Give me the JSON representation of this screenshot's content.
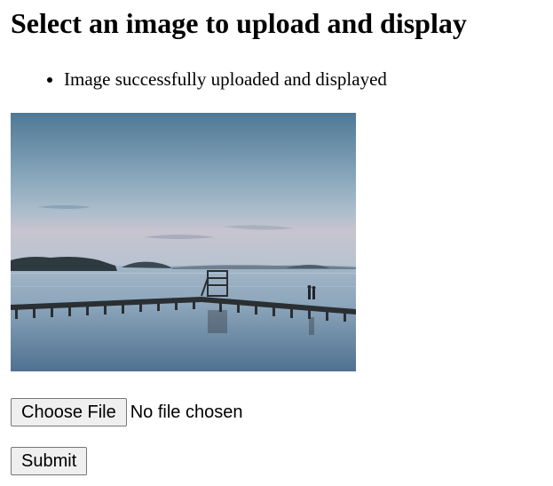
{
  "page": {
    "title": "Select an image to upload and display"
  },
  "messages": [
    "Image successfully uploaded and displayed"
  ],
  "preview": {
    "alt": "Uploaded image preview"
  },
  "form": {
    "choose_file_label": "Choose File",
    "file_status": "No file chosen",
    "submit_label": "Submit"
  }
}
